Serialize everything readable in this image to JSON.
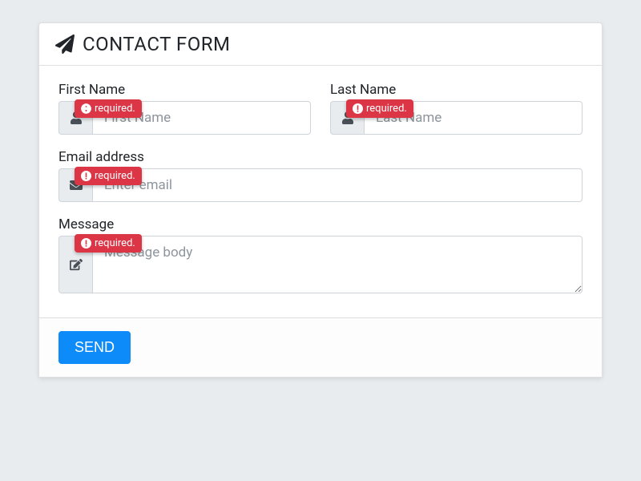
{
  "header": {
    "title": "CONTACT FORM"
  },
  "validation": {
    "required_text": "required."
  },
  "fields": {
    "first_name": {
      "label": "First Name",
      "placeholder": "First Name",
      "value": ""
    },
    "last_name": {
      "label": "Last Name",
      "placeholder": "Last Name",
      "value": ""
    },
    "email": {
      "label": "Email address",
      "placeholder": "Enter email",
      "value": ""
    },
    "message": {
      "label": "Message",
      "placeholder": "Message body",
      "value": ""
    }
  },
  "footer": {
    "submit_label": "SEND"
  },
  "colors": {
    "danger": "#dc3545",
    "primary": "#0d8bf9"
  }
}
